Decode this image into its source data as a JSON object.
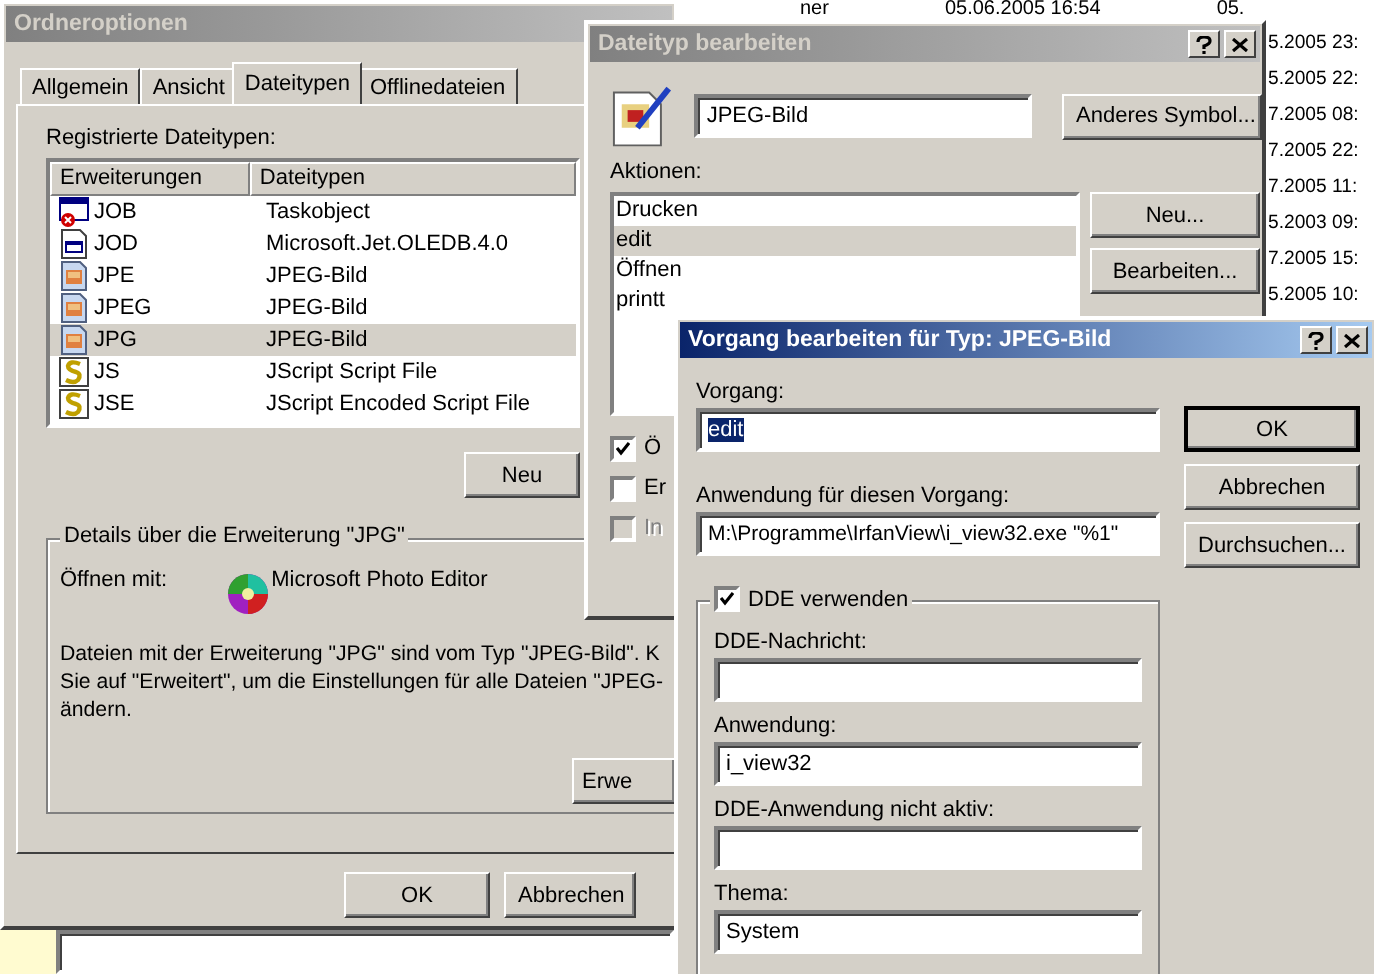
{
  "background_list": {
    "top_row": [
      "ner",
      "05.06.2005 16:54",
      "05."
    ],
    "dates": [
      "5.2005 23:",
      "5.2005 22:",
      "7.2005 08:",
      "7.2005 22:",
      "7.2005 11:",
      "5.2003 09:",
      "7.2005 15:",
      "5.2005 10:"
    ]
  },
  "folder_options": {
    "title": "Ordneroptionen",
    "active": false,
    "tabs": [
      {
        "label": "Allgemein",
        "selected": false
      },
      {
        "label": "Ansicht",
        "selected": false
      },
      {
        "label": "Dateitypen",
        "selected": true
      },
      {
        "label": "Offlinedateien",
        "selected": false
      }
    ],
    "registered_label": "Registrierte Dateitypen:",
    "columns": [
      "Erweiterungen",
      "Dateitypen"
    ],
    "rows": [
      {
        "kind": "task",
        "extension": "JOB",
        "file_type": "Taskobject",
        "selected": false
      },
      {
        "kind": "ole",
        "extension": "JOD",
        "file_type": "Microsoft.Jet.OLEDB.4.0",
        "selected": false
      },
      {
        "kind": "image",
        "extension": "JPE",
        "file_type": "JPEG-Bild",
        "selected": false
      },
      {
        "kind": "image",
        "extension": "JPEG",
        "file_type": "JPEG-Bild",
        "selected": false
      },
      {
        "kind": "image",
        "extension": "JPG",
        "file_type": "JPEG-Bild",
        "selected": true
      },
      {
        "kind": "script",
        "extension": "JS",
        "file_type": "JScript Script File",
        "selected": false
      },
      {
        "kind": "script",
        "extension": "JSE",
        "file_type": "JScript Encoded Script File",
        "selected": false
      }
    ],
    "new_button": "Neu",
    "details": {
      "title": "Details über die Erweiterung \"JPG\"",
      "open_with_label": "Öffnen mit:",
      "open_with_app": "Microsoft Photo Editor",
      "description_lines": [
        "Dateien mit der Erweiterung \"JPG\" sind vom Typ \"JPEG-Bild\". K",
        "Sie auf \"Erweitert\", um die Einstellungen für alle Dateien \"JPEG-",
        "ändern."
      ],
      "advanced_button": "Erwe"
    },
    "buttons": [
      "OK",
      "Abbrechen"
    ]
  },
  "edit_file_type": {
    "title": "Dateityp bearbeiten",
    "active": false,
    "type_name": "JPEG-Bild",
    "change_icon_button": "Anderes Symbol...",
    "actions_label": "Aktionen:",
    "actions": [
      {
        "label": "Drucken",
        "selected": false
      },
      {
        "label": "edit",
        "selected": true
      },
      {
        "label": "Öffnen",
        "selected": false
      },
      {
        "label": "printt",
        "selected": false
      }
    ],
    "buttons": [
      "Neu...",
      "Bearbeiten..."
    ],
    "checkboxes": [
      {
        "label": "Ö",
        "checked": true,
        "disabled": false
      },
      {
        "label": "Er",
        "checked": false,
        "disabled": false
      },
      {
        "label": "In",
        "checked": false,
        "disabled": true
      }
    ]
  },
  "edit_action": {
    "title": "Vorgang bearbeiten für Typ: JPEG-Bild",
    "active": true,
    "action_label": "Vorgang:",
    "action_value": "edit",
    "action_value_selected": true,
    "app_label": "Anwendung für diesen Vorgang:",
    "app_value": "M:\\Programme\\IrfanView\\i_view32.exe \"%1\"",
    "buttons": [
      "OK",
      "Abbrechen",
      "Durchsuchen..."
    ],
    "dde": {
      "label": "DDE verwenden",
      "checked": true,
      "fields": [
        {
          "label": "DDE-Nachricht:"
        },
        {
          "label": "Anwendung:",
          "value": "i_view32"
        },
        {
          "label": "DDE-Anwendung nicht aktiv:"
        },
        {
          "label": "Thema:",
          "value": "System"
        }
      ]
    }
  }
}
